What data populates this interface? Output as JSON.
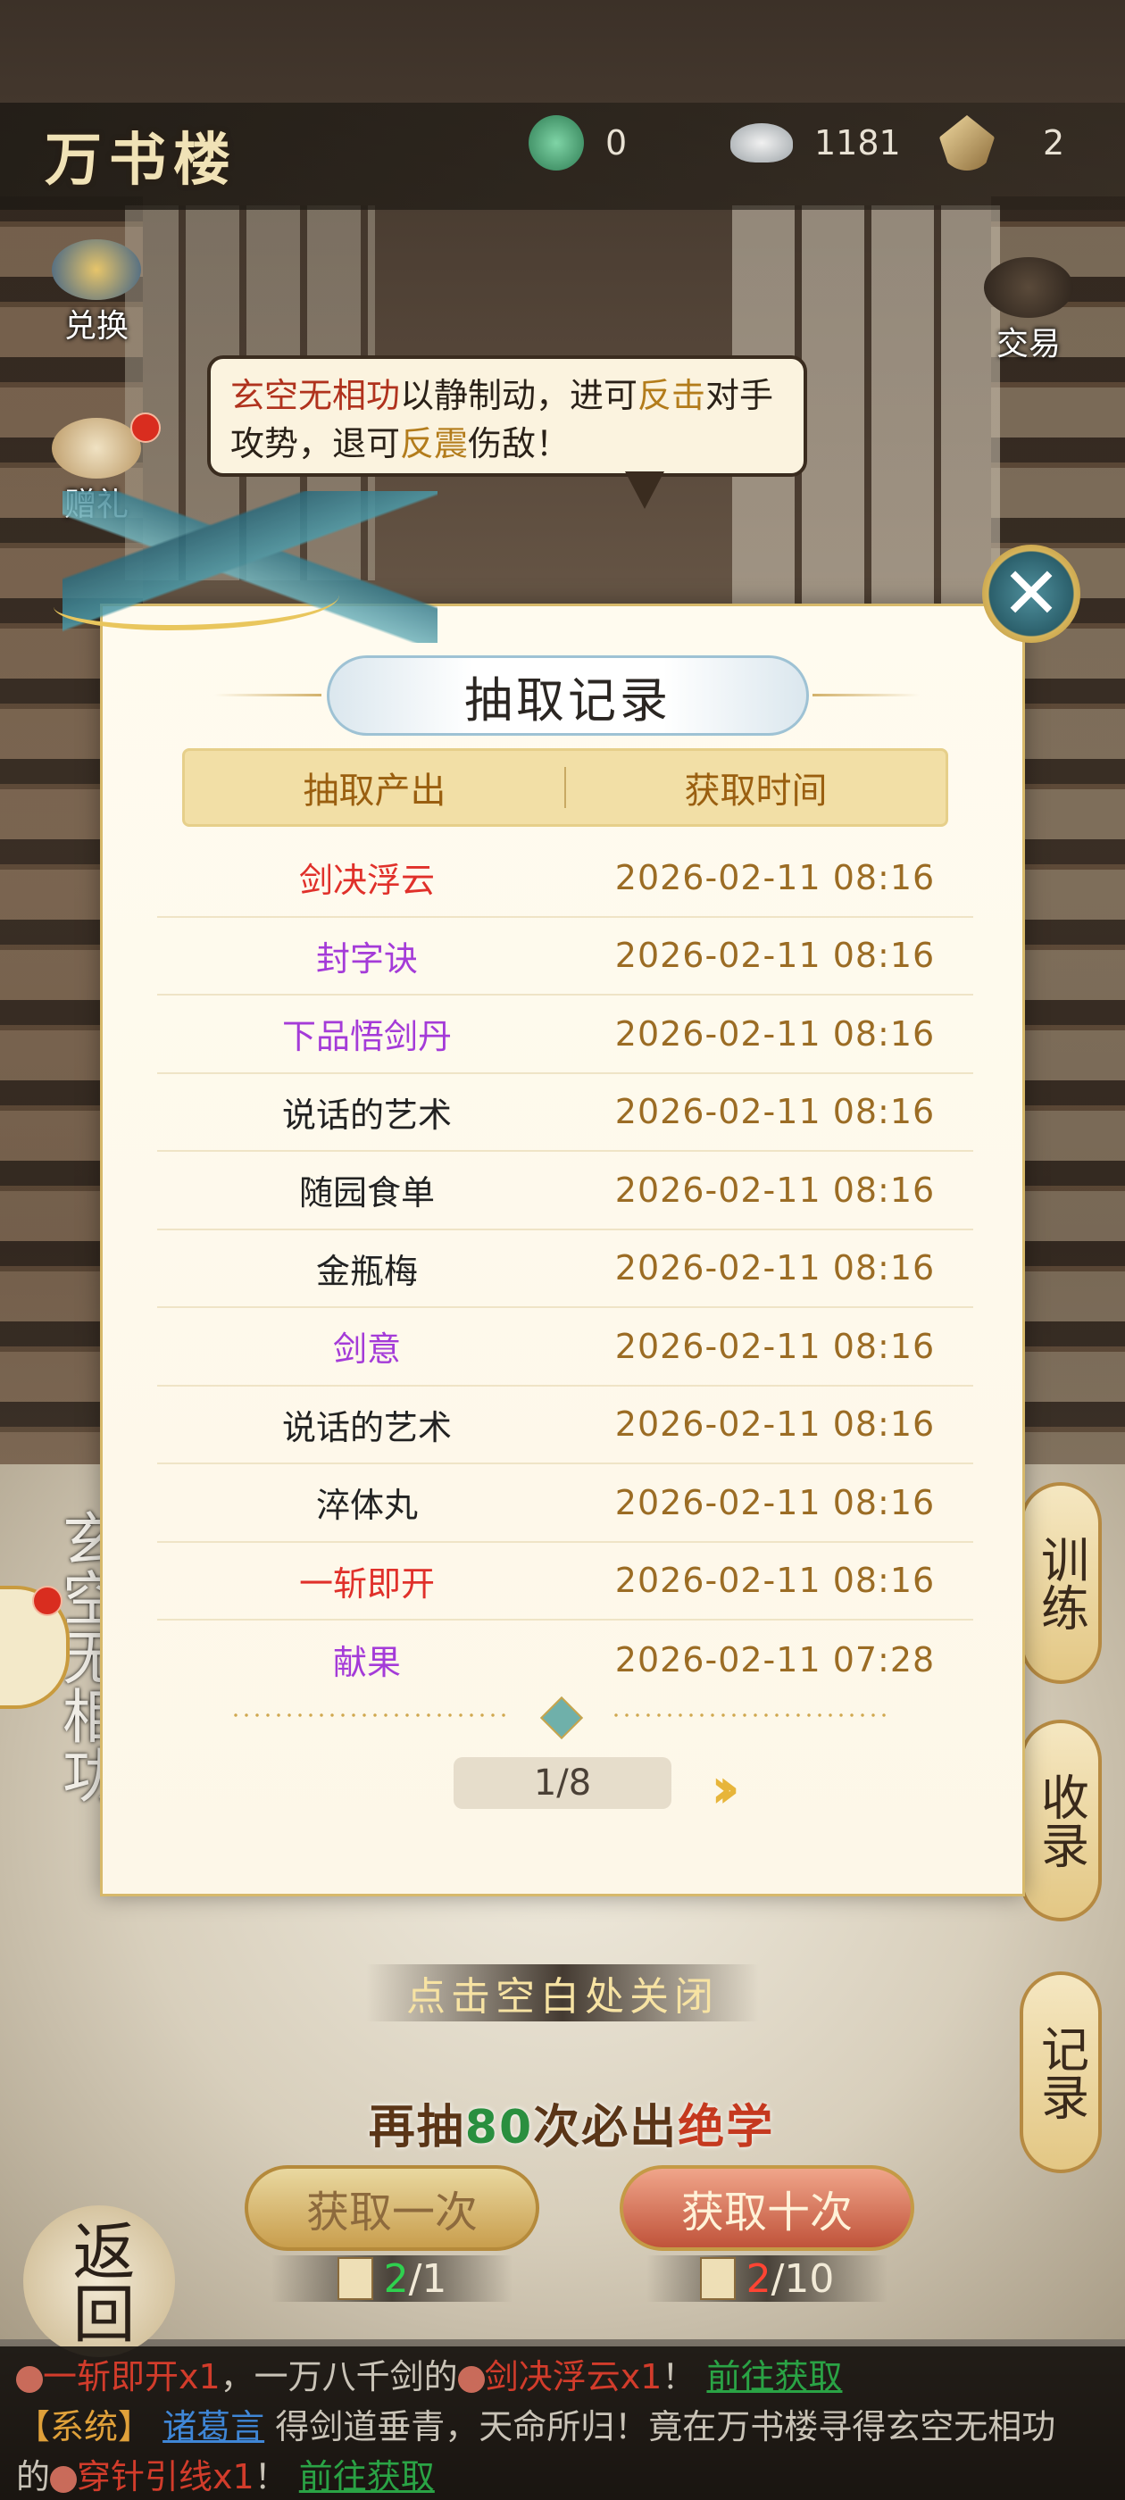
{
  "header": {
    "title": "万书楼",
    "resources": [
      {
        "icon": "jade-dragon-icon",
        "value": "0"
      },
      {
        "icon": "silver-ingot-icon",
        "value": "1181"
      },
      {
        "icon": "ticket-icon",
        "value": "2"
      }
    ]
  },
  "side_left": {
    "exchange_label": "兑换",
    "gift_label": "赠礼"
  },
  "side_right": {
    "trade_label": "交易"
  },
  "bubble": {
    "part1": "玄空无相功",
    "part2": "以静制动，进可",
    "part3": "反击",
    "part4": "对手攻势，退可",
    "part5": "反震",
    "part6": "伤敌！"
  },
  "modal": {
    "title": "抽取记录",
    "col_item": "抽取产出",
    "col_time": "获取时间",
    "records": [
      {
        "item": "剑决浮云",
        "quality": "red",
        "time": "2026-02-11   08:16"
      },
      {
        "item": "封字诀",
        "quality": "purple",
        "time": "2026-02-11   08:16"
      },
      {
        "item": "下品悟剑丹",
        "quality": "purple",
        "time": "2026-02-11   08:16"
      },
      {
        "item": "说话的艺术",
        "quality": "black",
        "time": "2026-02-11   08:16"
      },
      {
        "item": "随园食单",
        "quality": "black",
        "time": "2026-02-11   08:16"
      },
      {
        "item": "金瓶梅",
        "quality": "black",
        "time": "2026-02-11   08:16"
      },
      {
        "item": "剑意",
        "quality": "purple",
        "time": "2026-02-11   08:16"
      },
      {
        "item": "说话的艺术",
        "quality": "black",
        "time": "2026-02-11   08:16"
      },
      {
        "item": "淬体丸",
        "quality": "black",
        "time": "2026-02-11   08:16"
      },
      {
        "item": "一斩即开",
        "quality": "red",
        "time": "2026-02-11   08:16"
      },
      {
        "item": "献果",
        "quality": "purple",
        "time": "2026-02-11   07:28"
      }
    ],
    "page": "1/8",
    "next_icon": "double-chevron-right-icon"
  },
  "close_hint": "点击空白处关闭",
  "pull": {
    "hint_prefix": "再抽",
    "hint_num": "80",
    "hint_mid": "次必出",
    "hint_end": "绝学",
    "one_label": "获取一次",
    "ten_label": "获取十次",
    "one_cost_have": "2",
    "one_cost_need": "/1",
    "ten_cost_have": "2",
    "ten_cost_need": "/10"
  },
  "right_tabs": {
    "train": "训练",
    "collect": "收录",
    "record": "记录"
  },
  "left_vertical": "玄空无相功",
  "back_label": "返回",
  "news": {
    "l1a": "一斩即开x1",
    "l1b": "，一万八千剑的",
    "l1c": "剑决浮云x1",
    "l1d": "！ ",
    "l1e": "前往获取",
    "l2a": "【系统】",
    "l2b": "诸葛言",
    "l2c": " 得剑道垂青，天命所归！竟在万书楼寻得玄空无相功",
    "l3a": "的",
    "l3b": "穿针引线x1",
    "l3c": "！ ",
    "l3d": "前往获取"
  },
  "colors": {
    "quality_red": "#e0302a",
    "quality_purple": "#a43bd8",
    "time_gold": "#9b6c24",
    "header_gold": "#9a5f10"
  }
}
